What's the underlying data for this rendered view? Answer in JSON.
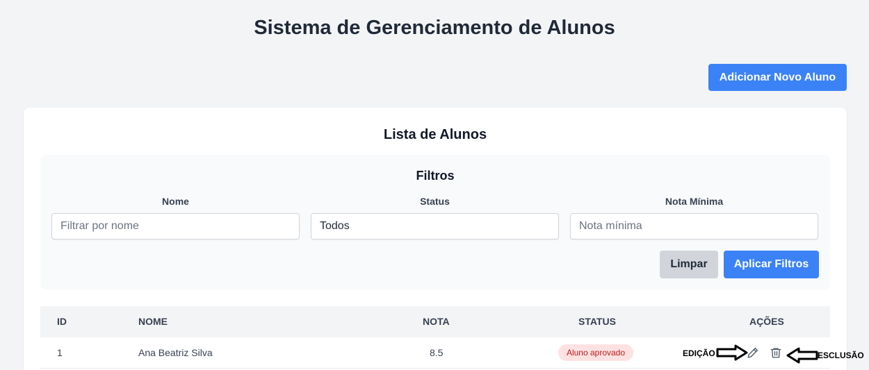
{
  "header": {
    "title": "Sistema de Gerenciamento de Alunos",
    "add_button": "Adicionar Novo Aluno"
  },
  "list": {
    "title": "Lista de Alunos",
    "filters": {
      "title": "Filtros",
      "name_label": "Nome",
      "name_placeholder": "Filtrar por nome",
      "status_label": "Status",
      "status_value": "Todos",
      "grade_label": "Nota Mínima",
      "grade_placeholder": "Nota mínima",
      "clear_button": "Limpar",
      "apply_button": "Aplicar Filtros"
    },
    "table": {
      "columns": [
        "ID",
        "NOME",
        "NOTA",
        "STATUS",
        "AÇÕES"
      ],
      "rows": [
        {
          "id": "1",
          "name": "Ana Beatriz Silva",
          "grade": "8.5",
          "status": "Aluno aprovado"
        }
      ]
    }
  },
  "annotations": {
    "edit_label": "EDIÇÃO",
    "delete_label": "ESCLUSÃO"
  },
  "icons": {
    "edit": "pencil-icon",
    "delete": "trash-icon",
    "arrow_right": "arrow-right-icon",
    "arrow_left": "arrow-left-icon"
  },
  "colors": {
    "primary": "#3b82f6",
    "badge_bg": "#fee2e2",
    "badge_text": "#b91c1c"
  }
}
